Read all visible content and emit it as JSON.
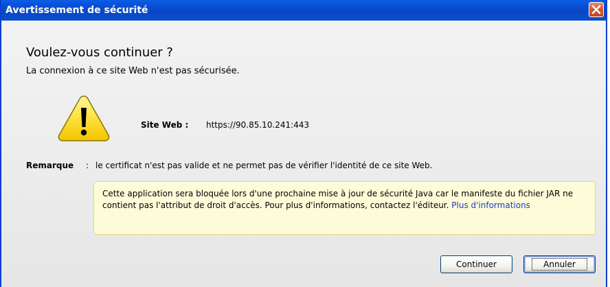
{
  "window": {
    "title": "Avertissement de sécurité",
    "close_icon": "close-icon"
  },
  "content": {
    "heading": "Voulez-vous continuer ?",
    "subheading": "La connexion à ce site Web n'est pas sécurisée.",
    "warning_icon": "warning-triangle-icon",
    "site_label": "Site Web :",
    "site_value": "https://90.85.10.241:443",
    "note_label": "Remarque",
    "note_separator": ":",
    "note_text": "le certificat n'est pas valide et ne permet pas de vérifier l'identité de ce site Web."
  },
  "infobox": {
    "text": "Cette application sera bloquée lors d'une prochaine mise à jour de sécurité Java car le manifeste du fichier JAR ne contient pas l'attribut de droit d'accès. Pour plus d'informations, contactez l'éditeur. ",
    "link": "Plus d'informations"
  },
  "buttons": {
    "continue_label": "Continuer",
    "cancel_label": "Annuler"
  },
  "colors": {
    "titlebar": "#0a52d8",
    "close_button": "#d6582f",
    "infobox_background": "#fefbd8",
    "link": "#1a3cc8"
  }
}
